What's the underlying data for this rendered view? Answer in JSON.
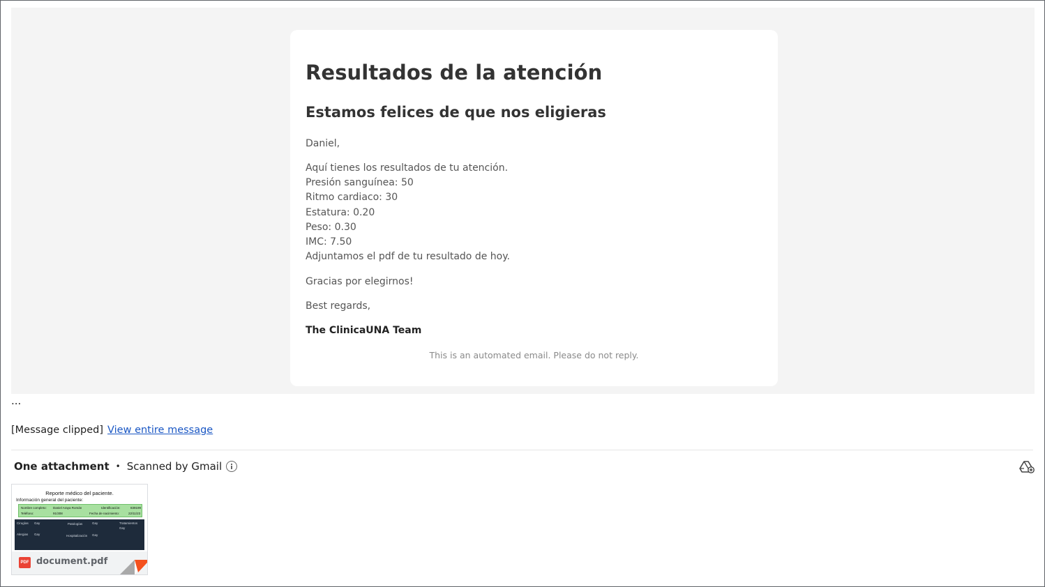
{
  "email": {
    "title": "Resultados de la atención",
    "subtitle": "Estamos felices de que nos eligieras",
    "greeting": "Daniel,",
    "intro": "Aquí tienes los resultados de tu atención.",
    "results": [
      "Presión sanguínea: 50",
      "Ritmo cardiaco: 30",
      "Estatura: 0.20",
      "Peso: 0.30",
      "IMC: 7.50"
    ],
    "pdf_note": "Adjuntamos el pdf de tu resultado de hoy.",
    "thanks": "Gracias por elegirnos!",
    "regards": "Best regards,",
    "signature": "The ClinicaUNA Team",
    "automated_note": "This is an automated email. Please do not reply."
  },
  "ellipsis": "...",
  "clipped": {
    "label": "[Message clipped]",
    "link": "View entire message"
  },
  "attachments": {
    "count_label": "One attachment",
    "separator": "•",
    "scan_label": "Scanned by Gmail",
    "info_icon": "info-icon",
    "drive_icon": "add-to-drive-icon",
    "file": {
      "name": "document.pdf",
      "type_badge": "PDF",
      "preview": {
        "title": "Reporte médico del paciente.",
        "section": "Información general del paciente:",
        "fields": {
          "nombre_label": "Nombre completo:",
          "nombre_value": "Daniel Araya Román",
          "id_label": "Identificación:",
          "id_value": "839199",
          "tel_label": "Teléfono:",
          "tel_value": "91/308",
          "fecha_label": "Fecha de nacimiento:",
          "fecha_value": "22/11/23",
          "cirugias": "Cirugías",
          "patologias": "Patologías",
          "tratamientos": "Tratamientos",
          "alergias": "Alergias",
          "hospitalizacion": "Hospitalización",
          "ninguno": "Gay"
        }
      }
    }
  },
  "colors": {
    "link": "#1a57c4",
    "pdf_red": "#ea4335",
    "email_bg": "#f4f4f4"
  }
}
